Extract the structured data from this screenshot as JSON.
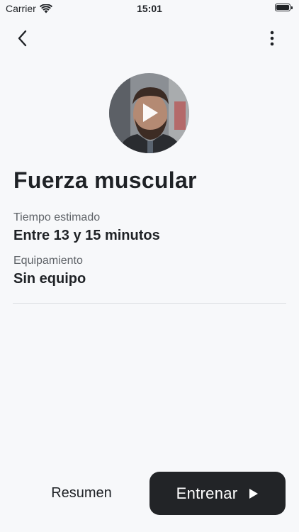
{
  "status_bar": {
    "carrier": "Carrier",
    "time": "15:01",
    "icons": [
      "wifi-icon",
      "battery-icon"
    ]
  },
  "nav": {
    "back_icon": "chevron-left-icon",
    "more_icon": "vertical-ellipsis-icon"
  },
  "media": {
    "play_icon": "play-icon"
  },
  "workout": {
    "title": "Fuerza muscular",
    "time_label": "Tiempo estimado",
    "time_value": "Entre 13 y 15 minutos",
    "equipment_label": "Equipamiento",
    "equipment_value": "Sin equipo"
  },
  "actions": {
    "summary_label": "Resumen",
    "train_label": "Entrenar",
    "train_icon": "play-icon"
  },
  "colors": {
    "background": "#f7f8fa",
    "primary_button": "#222427",
    "text": "#1f2226",
    "secondary_text": "#5f6368"
  }
}
